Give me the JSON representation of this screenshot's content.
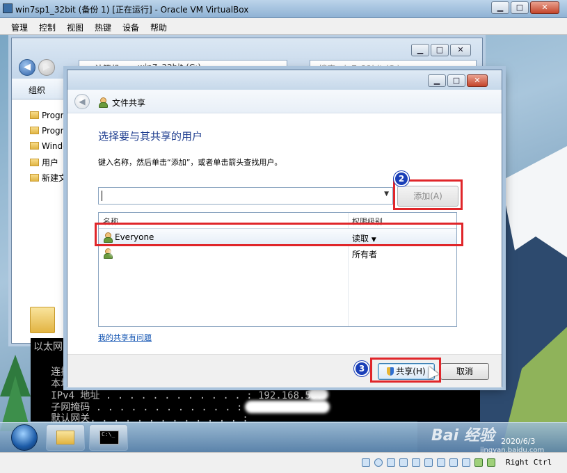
{
  "vbox": {
    "title": "win7sp1_32bit (备份 1) [正在运行] - Oracle VM VirtualBox",
    "menu": [
      "管理",
      "控制",
      "视图",
      "热键",
      "设备",
      "帮助"
    ],
    "hostkey": "Right Ctrl"
  },
  "explorer": {
    "breadcrumb": [
      "计算机",
      "win7_32bit (C:)"
    ],
    "search_placeholder": "搜索 win7_32bit (C:)",
    "organize": "组织",
    "tree": [
      "Progra",
      "Progra",
      "Windo",
      "用户",
      "新建文"
    ]
  },
  "cmd": {
    "lines": [
      "以太网",
      "   连接",
      "   本地",
      "   IPv4 地址 . . . . . . . . . . . . : 192.168.56.",
      "   子网掩码 . . . . . . . . . . . . :",
      "   默认网关. . . . . . . . . . . . . :"
    ]
  },
  "dialog": {
    "title": "文件共享",
    "heading": "选择要与其共享的用户",
    "instruction": "键入名称，然后单击“添加”，或者单击箭头查找用户。",
    "add_label": "添加(A)",
    "columns": [
      "名称",
      "权限级别"
    ],
    "rows": [
      {
        "name": "Everyone",
        "permission": "读取"
      },
      {
        "name": "",
        "permission": "所有者"
      }
    ],
    "help_link": "我的共享有问题",
    "share_label": "共享(H)",
    "cancel_label": "取消"
  },
  "annotations": {
    "badges": [
      "2",
      "3"
    ],
    "accent": "#e0262a",
    "badge_color": "#1a3fb8"
  },
  "taskbar": {
    "date": "2020/6/3"
  },
  "watermark": {
    "text": "Bai 经验",
    "sub": "jingyan.baidu.com"
  }
}
